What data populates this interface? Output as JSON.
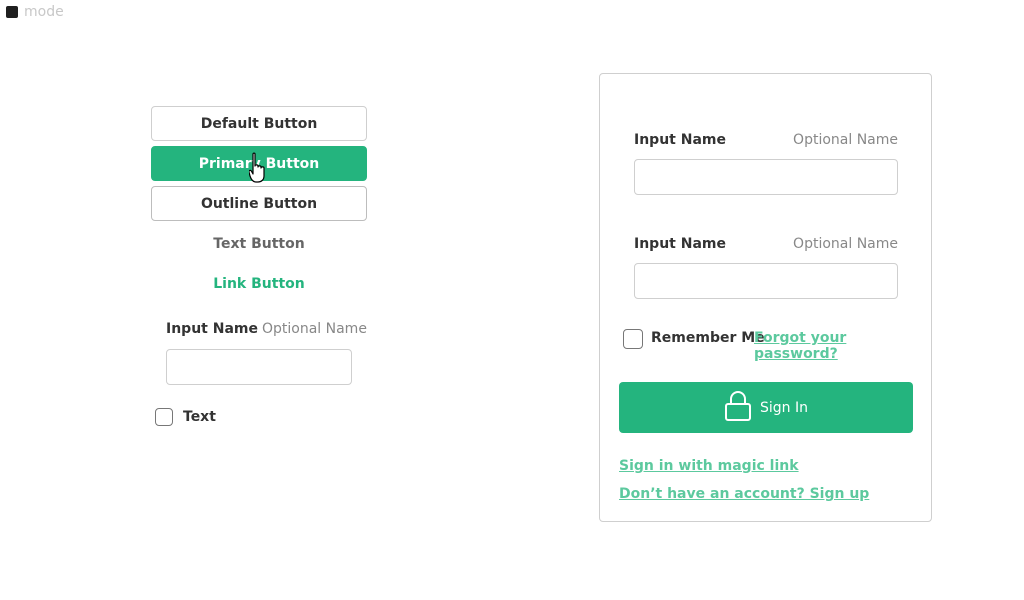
{
  "mode": {
    "label": "mode"
  },
  "buttons": {
    "default_label": "Default Button",
    "primary_label": "Primary Button",
    "outline_label": "Outline Button",
    "text_label": "Text Button",
    "link_label": "Link Button"
  },
  "left_form": {
    "input_label": "Input Name",
    "input_optional": "Optional Name",
    "input_value": "",
    "checkbox_label": "Text"
  },
  "auth": {
    "field1": {
      "label": "Input Name",
      "optional": "Optional Name",
      "value": ""
    },
    "field2": {
      "label": "Input Name",
      "optional": "Optional Name",
      "value": ""
    },
    "remember_label": "Remember Me",
    "forgot_label": "Forgot your password?",
    "signin_label": "Sign In",
    "magic_link_label": "Sign in with magic link",
    "signup_label": "Don’t have an account? Sign up"
  },
  "colors": {
    "accent": "#24b47e",
    "accent_light": "#5cc99e",
    "border": "#cfcfcf"
  },
  "icons": {
    "mode": "square-swatch-icon",
    "signin": "lock-icon",
    "cursor": "hand-pointer-icon"
  }
}
